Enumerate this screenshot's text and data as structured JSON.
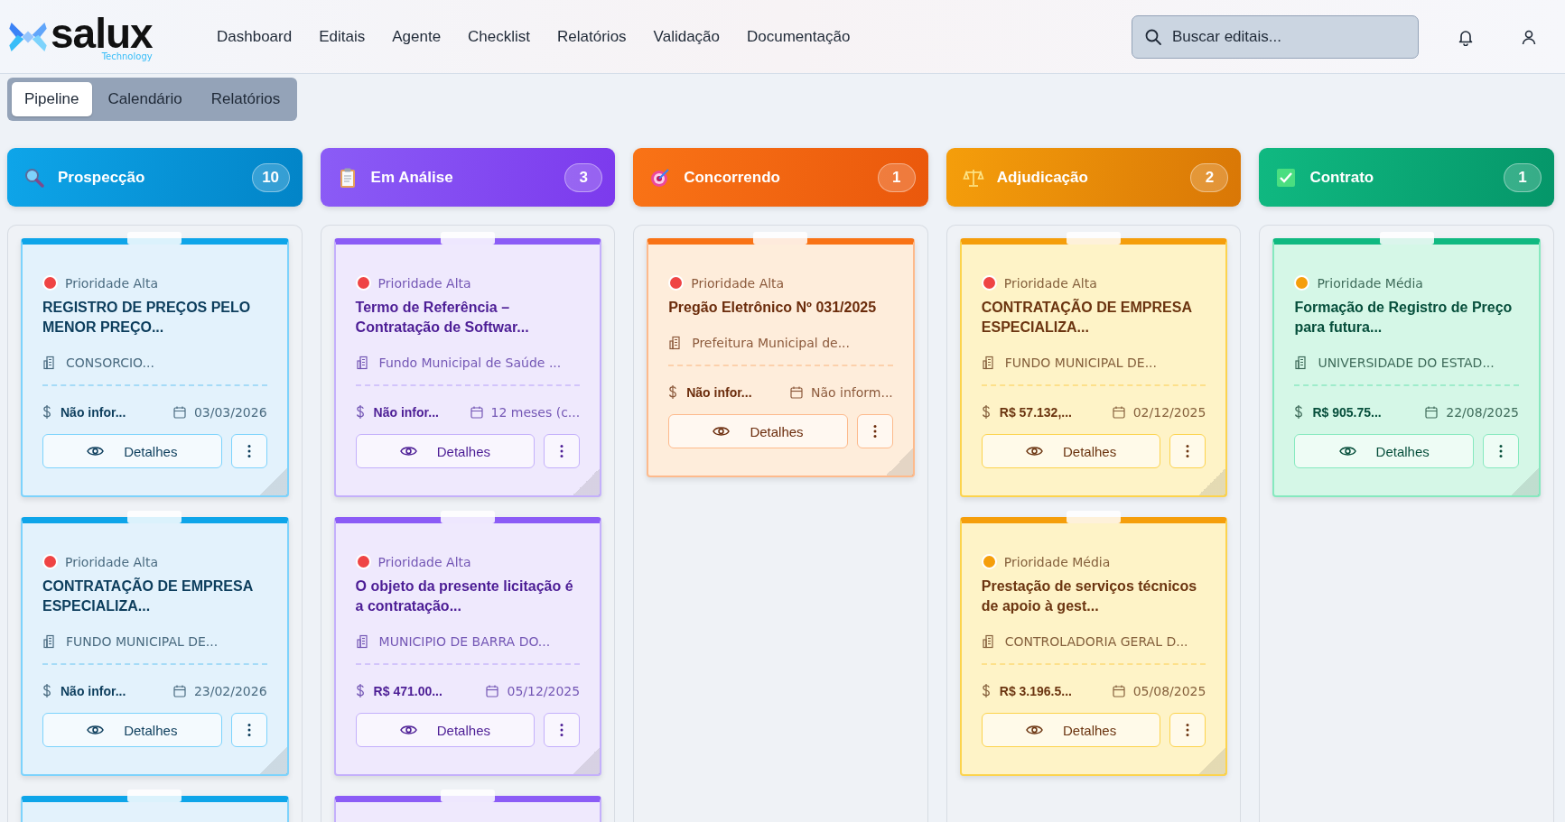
{
  "header": {
    "logo": {
      "name": "salux",
      "tagline": "Technology"
    },
    "nav": [
      "Dashboard",
      "Editais",
      "Agente",
      "Checklist",
      "Relatórios",
      "Validação",
      "Documentação"
    ],
    "search": {
      "placeholder": "Buscar editais..."
    }
  },
  "tabs": [
    {
      "label": "Pipeline",
      "selected": true
    },
    {
      "label": "Calendário",
      "selected": false
    },
    {
      "label": "Relatórios",
      "selected": false
    }
  ],
  "columns": [
    {
      "title": "Prospecção",
      "count": "10",
      "kind": "search",
      "color": "#0ea5e9",
      "more_cards": true,
      "cards": [
        {
          "priority": "Prioridade Alta",
          "color": "#ef4444",
          "title": "REGISTRO DE PREÇOS PELO MENOR PREÇO...",
          "agency": "CONSORCIO...",
          "value": "Não infor...",
          "date": "03/03/2026",
          "button": "Detalhes"
        },
        {
          "priority": "Prioridade Alta",
          "color": "#ef4444",
          "title": "CONTRATAÇÃO DE EMPRESA ESPECIALIZA...",
          "agency": "FUNDO MUNICIPAL DE...",
          "value": "Não infor...",
          "date": "23/02/2026",
          "button": "Detalhes"
        }
      ]
    },
    {
      "title": "Em Análise",
      "count": "3",
      "kind": "clipboard",
      "color": "#8b5cf6",
      "more_cards": true,
      "cards": [
        {
          "priority": "Prioridade Alta",
          "color": "#ef4444",
          "title": "Termo de Referência – Contratação de Softwar...",
          "agency": "Fundo Municipal de Saúde ...",
          "value": "Não infor...",
          "date": "12 meses (c...",
          "button": "Detalhes"
        },
        {
          "priority": "Prioridade Alta",
          "color": "#ef4444",
          "title": "O objeto da presente licitação é a contratação...",
          "agency": "MUNICIPIO DE BARRA DO...",
          "value": "R$ 471.00...",
          "date": "05/12/2025",
          "button": "Detalhes"
        }
      ]
    },
    {
      "title": "Concorrendo",
      "count": "1",
      "kind": "target",
      "color": "#f97316",
      "more_cards": false,
      "cards": [
        {
          "priority": "Prioridade Alta",
          "color": "#ef4444",
          "title": "Pregão Eletrônico Nº 031/2025",
          "agency": "Prefeitura Municipal de...",
          "value": "Não infor...",
          "date": "Não inform...",
          "button": "Detalhes"
        }
      ]
    },
    {
      "title": "Adjudicação",
      "count": "2",
      "kind": "scales",
      "color": "#f59e0b",
      "more_cards": false,
      "cards": [
        {
          "priority": "Prioridade Alta",
          "color": "#ef4444",
          "title": "CONTRATAÇÃO DE EMPRESA ESPECIALIZA...",
          "agency": "FUNDO MUNICIPAL DE...",
          "value": "R$ 57.132,...",
          "date": "02/12/2025",
          "button": "Detalhes"
        },
        {
          "priority": "Prioridade Média",
          "color": "#f59e0b",
          "title": "Prestação de serviços técnicos de apoio à gest...",
          "agency": "CONTROLADORIA GERAL D...",
          "value": "R$ 3.196.5...",
          "date": "05/08/2025",
          "button": "Detalhes"
        }
      ]
    },
    {
      "title": "Contrato",
      "count": "1",
      "kind": "check",
      "color": "#10b981",
      "more_cards": false,
      "cards": [
        {
          "priority": "Prioridade Média",
          "color": "#f59e0b",
          "title": "Formação de Registro de Preço para futura...",
          "agency": "UNIVERSIDADE DO ESTAD...",
          "value": "R$ 905.75...",
          "date": "22/08/2025",
          "button": "Detalhes"
        }
      ]
    }
  ]
}
